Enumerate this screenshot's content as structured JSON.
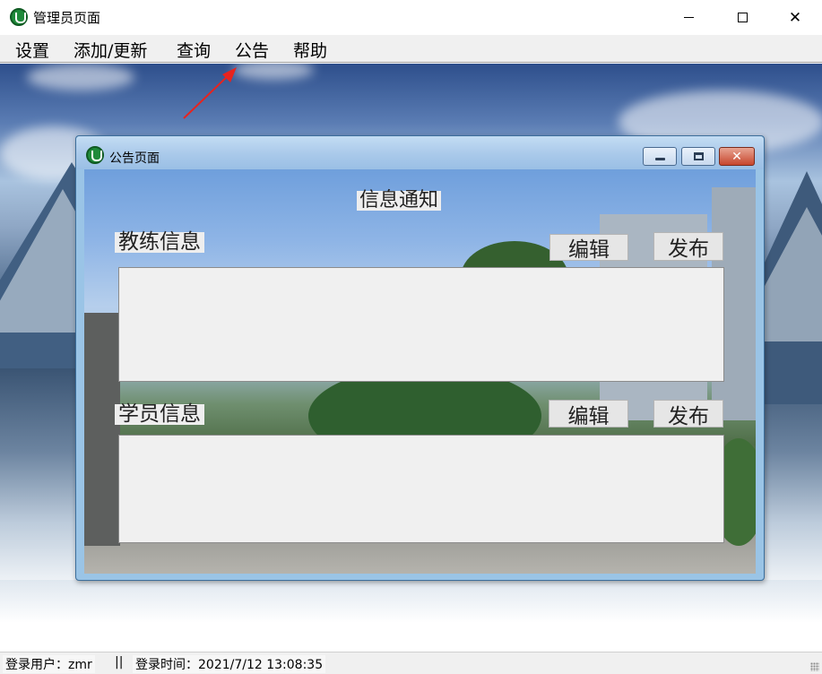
{
  "window": {
    "title": "管理员页面",
    "icons": {
      "app": "app-logo-icon",
      "minimize": "minimize-icon",
      "maximize": "maximize-icon",
      "close": "close-icon"
    },
    "close_glyph": "✕"
  },
  "menu": {
    "items": [
      {
        "label": "设置"
      },
      {
        "label": "添加/更新"
      },
      {
        "label": "查询"
      },
      {
        "label": "公告"
      },
      {
        "label": "帮助"
      }
    ]
  },
  "annotation": {
    "arrow_color": "#e8231e",
    "arrow_icon": "red-arrow-icon"
  },
  "dialog": {
    "title": "公告页面",
    "close_glyph": "✕",
    "heading": "信息通知",
    "coach": {
      "label": "教练信息",
      "edit_button": "编辑",
      "publish_button": "发布",
      "text": ""
    },
    "student": {
      "label": "学员信息",
      "edit_button": "编辑",
      "publish_button": "发布",
      "text": ""
    }
  },
  "status": {
    "user": "登录用户：zmr",
    "separator": "||",
    "login_time": "登录时间：2021/7/12 13:08:35"
  }
}
